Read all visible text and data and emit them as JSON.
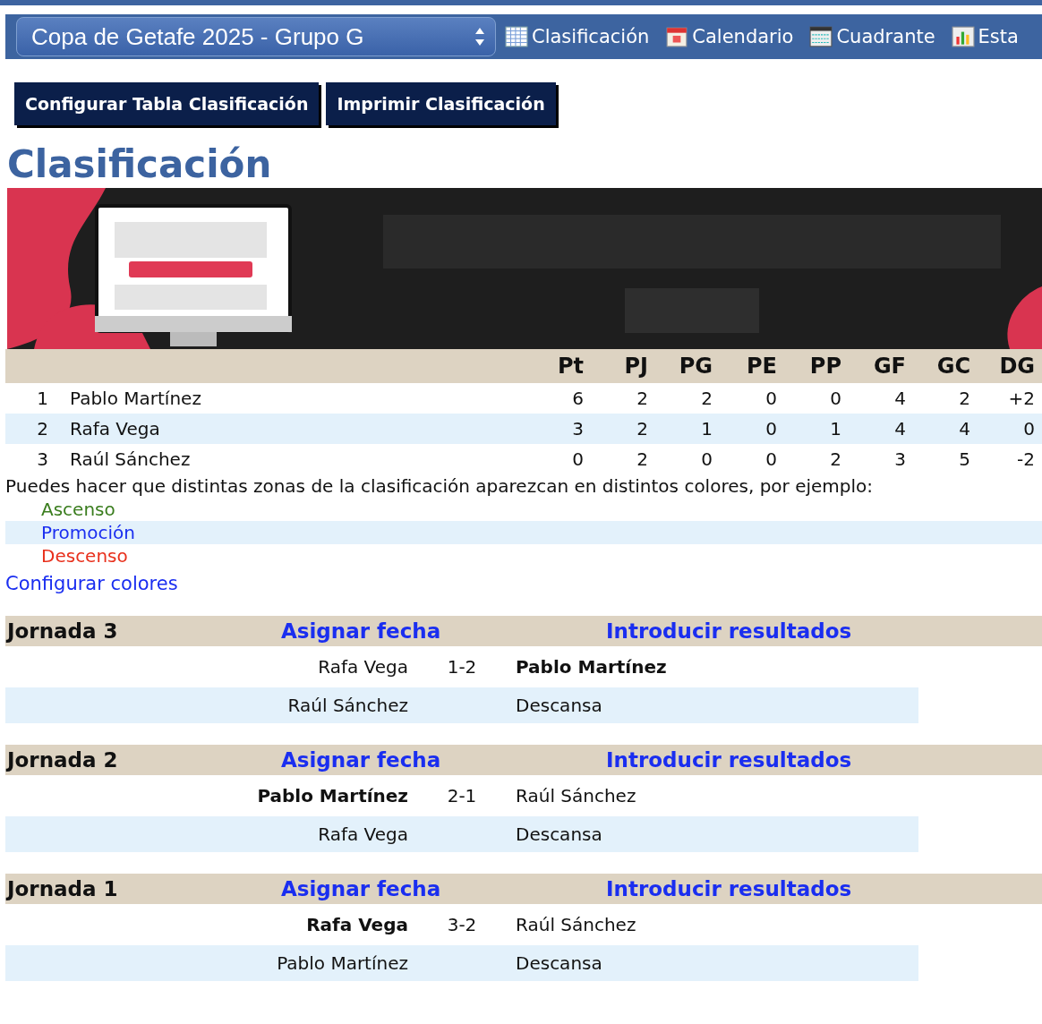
{
  "competition_select": {
    "value": "Copa de Getafe 2025 - Grupo G"
  },
  "nav": [
    {
      "label": "Clasificación",
      "kind": "grid"
    },
    {
      "label": "Calendario",
      "kind": "calendar"
    },
    {
      "label": "Cuadrante",
      "kind": "table"
    },
    {
      "label": "Esta",
      "kind": "chart"
    }
  ],
  "buttons": [
    "Configurar Tabla Clasificación",
    "Imprimir Clasificación"
  ],
  "heading": "Clasificación",
  "banner": {
    "kind": "picture"
  },
  "standings": {
    "columns": [
      "Pt",
      "PJ",
      "PG",
      "PE",
      "PP",
      "GF",
      "GC",
      "DG"
    ],
    "rows": [
      {
        "rank": "1",
        "team": "Pablo Martínez",
        "values": [
          "6",
          "2",
          "2",
          "0",
          "0",
          "4",
          "2",
          "+2"
        ]
      },
      {
        "rank": "2",
        "team": "Rafa Vega",
        "values": [
          "3",
          "2",
          "1",
          "0",
          "1",
          "4",
          "4",
          "0"
        ]
      },
      {
        "rank": "3",
        "team": "Raúl Sánchez",
        "values": [
          "0",
          "2",
          "0",
          "0",
          "2",
          "3",
          "5",
          "-2"
        ]
      }
    ]
  },
  "zones_note": "Puedes hacer que distintas zonas de la clasificación aparezcan en distintos colores, por ejemplo:",
  "zones": [
    {
      "label": "Ascenso",
      "color": "#3a7d1e"
    },
    {
      "label": "Promoción",
      "color": "#1a2ef0"
    },
    {
      "label": "Descenso",
      "color": "#e8301c"
    }
  ],
  "configure_colors_link": "Configurar colores",
  "rounds": [
    {
      "title": "Jornada 3",
      "date_link": "Asignar fecha",
      "results_link": "Introducir resultados",
      "matches": [
        {
          "kind": "match",
          "home": "Rafa Vega",
          "score": "1-2",
          "away": "Pablo Martínez",
          "home_won": false,
          "away_won": true
        },
        {
          "kind": "rest",
          "team": "Raúl Sánchez",
          "label": "Descansa"
        }
      ]
    },
    {
      "title": "Jornada 2",
      "date_link": "Asignar fecha",
      "results_link": "Introducir resultados",
      "matches": [
        {
          "kind": "match",
          "home": "Pablo Martínez",
          "score": "2-1",
          "away": "Raúl Sánchez",
          "home_won": true,
          "away_won": false
        },
        {
          "kind": "rest",
          "team": "Rafa Vega",
          "label": "Descansa"
        }
      ]
    },
    {
      "title": "Jornada 1",
      "date_link": "Asignar fecha",
      "results_link": "Introducir resultados",
      "matches": [
        {
          "kind": "match",
          "home": "Rafa Vega",
          "score": "3-2",
          "away": "Raúl Sánchez",
          "home_won": true,
          "away_won": false
        },
        {
          "kind": "rest",
          "team": "Pablo Martínez",
          "label": "Descansa"
        }
      ]
    }
  ]
}
